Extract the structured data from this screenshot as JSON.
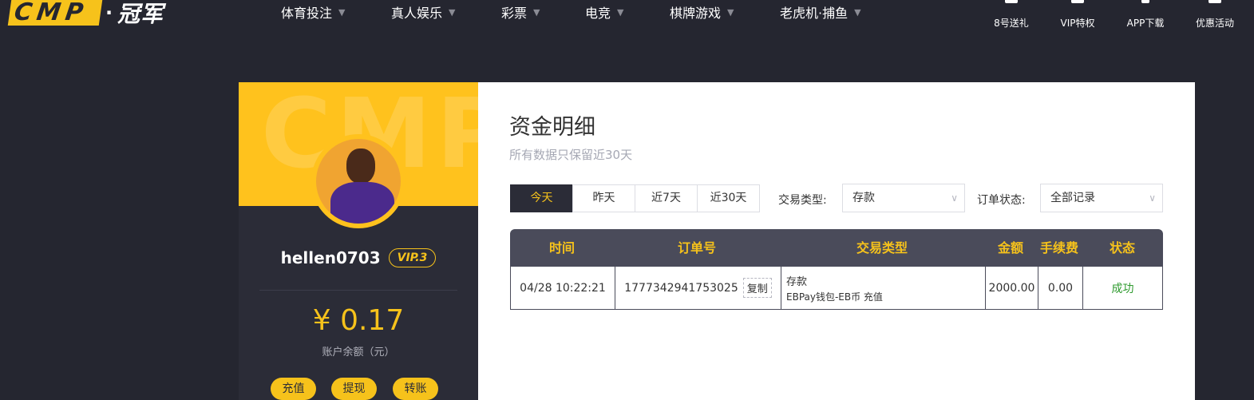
{
  "brand": {
    "logo_text": "CMP",
    "dot": "·",
    "name": "冠军"
  },
  "nav": [
    {
      "label": "体育投注"
    },
    {
      "label": "真人娱乐"
    },
    {
      "label": "彩票"
    },
    {
      "label": "电竞"
    },
    {
      "label": "棋牌游戏"
    },
    {
      "label": "老虎机·捕鱼"
    }
  ],
  "quick_links": [
    {
      "label": "8号送礼",
      "icon": "gift-icon"
    },
    {
      "label": "VIP特权",
      "icon": "crown-icon"
    },
    {
      "label": "APP下载",
      "icon": "phone-icon"
    },
    {
      "label": "优惠活动",
      "icon": "grid-icon"
    }
  ],
  "profile": {
    "watermark": "CMP",
    "username": "hellen0703",
    "vip": "VIP.3",
    "balance": "¥ 0.17",
    "balance_label": "账户余额（元）",
    "actions": [
      "充值",
      "提现",
      "转账"
    ]
  },
  "content": {
    "title": "资金明细",
    "subtitle": "所有数据只保留近30天",
    "date_tabs": [
      "今天",
      "昨天",
      "近7天",
      "近30天"
    ],
    "active_tab": 0,
    "filters": {
      "type_label": "交易类型:",
      "type_value": "存款",
      "status_label": "订单状态:",
      "status_value": "全部记录"
    },
    "table": {
      "headers": [
        "时间",
        "订单号",
        "交易类型",
        "金额",
        "手续费",
        "状态"
      ],
      "rows": [
        {
          "time": "04/28 10:22:21",
          "order_no": "1777342941753025",
          "copy_label": "复制",
          "type_main": "存款",
          "type_sub": "EBPay钱包-EB币 充值",
          "amount": "2000.00",
          "fee": "0.00",
          "status": "成功"
        }
      ]
    }
  },
  "colors": {
    "accent": "#f6c21b",
    "dark": "#252630",
    "panel": "#2b2c37",
    "success": "#2e9a2e"
  }
}
